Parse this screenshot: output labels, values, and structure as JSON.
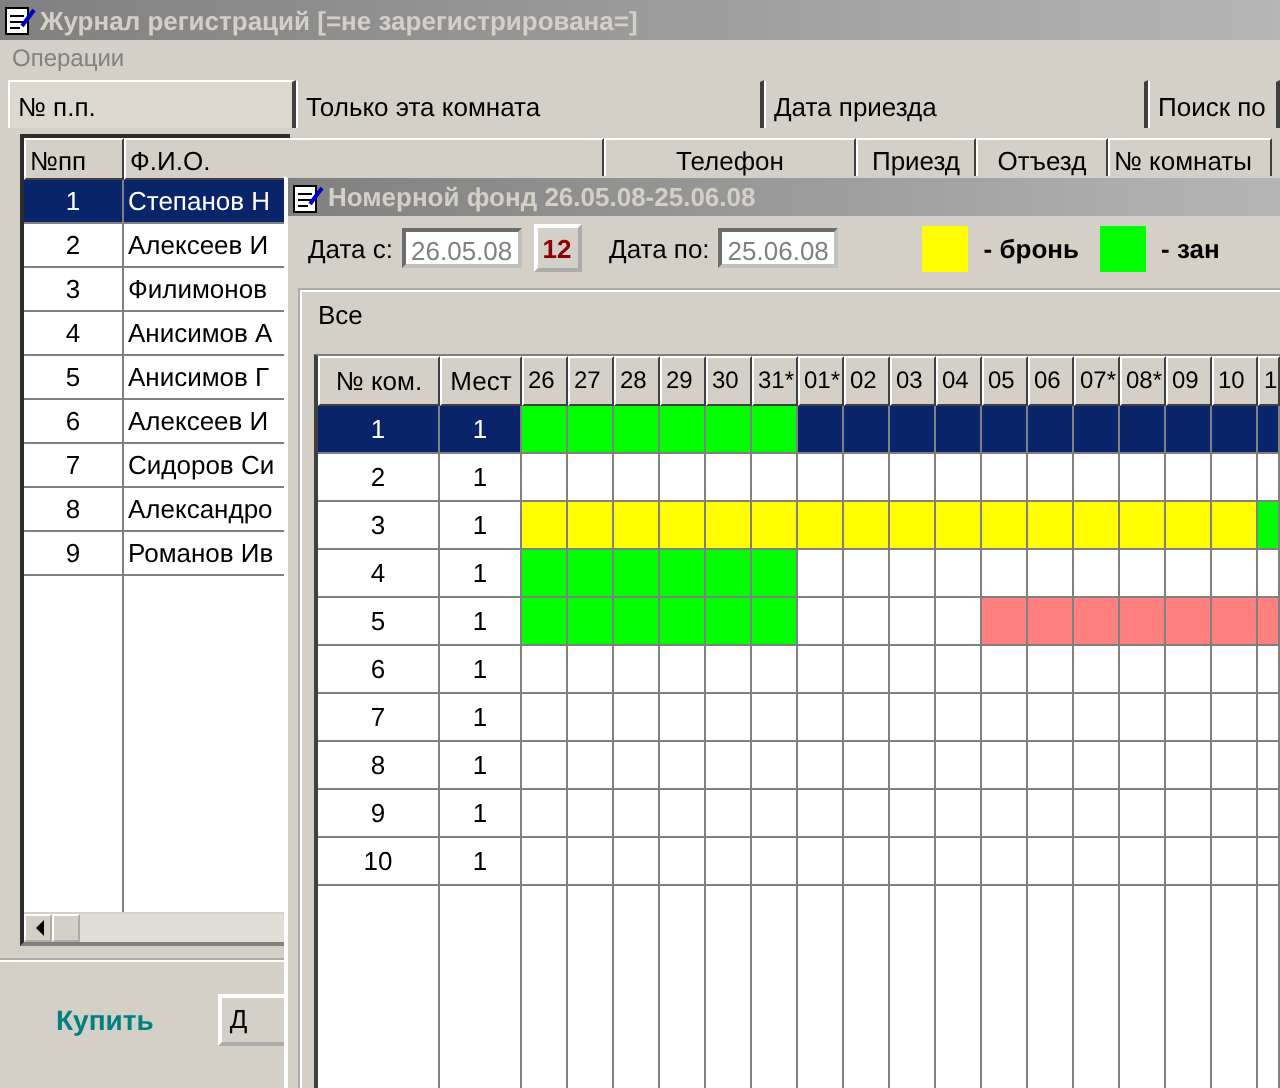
{
  "window": {
    "title": "Журнал регистраций [=не зарегистрирована=]"
  },
  "menu": [
    "Операции"
  ],
  "tabs": [
    {
      "label": "№ п.п.",
      "selected": true
    },
    {
      "label": "Только эта комната",
      "selected": false
    },
    {
      "label": "Дата приезда",
      "selected": false
    },
    {
      "label": "Поиск по",
      "selected": false
    }
  ],
  "guests": {
    "columns": [
      "№пп",
      "Ф.И.О.",
      "Телефон",
      "Приезд",
      "Отъезд",
      "№ комнаты"
    ],
    "rows": [
      {
        "number": "1",
        "name": "Степанов Н",
        "selected": true
      },
      {
        "number": "2",
        "name": "Алексеев И",
        "selected": false
      },
      {
        "number": "3",
        "name": "Филимонов",
        "selected": false
      },
      {
        "number": "4",
        "name": "Анисимов А",
        "selected": false
      },
      {
        "number": "5",
        "name": "Анисимов Г",
        "selected": false
      },
      {
        "number": "6",
        "name": "Алексеев И",
        "selected": false
      },
      {
        "number": "7",
        "name": "Сидоров Си",
        "selected": false
      },
      {
        "number": "8",
        "name": "Александро",
        "selected": false
      },
      {
        "number": "9",
        "name": "Романов Ив",
        "selected": false
      }
    ]
  },
  "buttons": [
    {
      "label": "Купить",
      "kind": "link"
    },
    {
      "label": "Д",
      "kind": "push"
    }
  ],
  "room_window": {
    "title": "Номерной фонд 26.05.08-25.06.08",
    "date_from": {
      "label": "Дата с:",
      "value": "26.05.08"
    },
    "calendar_button": "12",
    "date_to": {
      "label": "Дата по:",
      "value": "25.06.08"
    },
    "legend": [
      {
        "color": "#ffff00",
        "label": "- бронь"
      },
      {
        "color": "#00ff00",
        "label": "- зан"
      }
    ],
    "group": "Все",
    "columns": [
      "№ ком.",
      "Мест"
    ],
    "days": [
      "26",
      "27",
      "28",
      "29",
      "30",
      "31*",
      "01*",
      "02",
      "03",
      "04",
      "05",
      "06",
      "07*",
      "08*",
      "09",
      "10",
      "1"
    ],
    "rooms": [
      {
        "number": "1",
        "places": "1",
        "selected": true,
        "days": [
          {
            "kind": "occupied"
          },
          {
            "kind": "occupied"
          },
          {
            "kind": "occupied"
          },
          {
            "kind": "occupied"
          },
          {
            "kind": "occupied"
          },
          {
            "kind": "occupied"
          },
          {
            "kind": "free"
          },
          {
            "kind": "free"
          },
          {
            "kind": "free"
          },
          {
            "kind": "free"
          },
          {
            "kind": "free"
          },
          {
            "kind": "free"
          },
          {
            "kind": "free"
          },
          {
            "kind": "free"
          },
          {
            "kind": "free"
          },
          {
            "kind": "free"
          },
          {
            "kind": "free"
          }
        ]
      },
      {
        "number": "2",
        "places": "1",
        "selected": false,
        "days": [
          {
            "kind": "free"
          },
          {
            "kind": "free"
          },
          {
            "kind": "free"
          },
          {
            "kind": "free"
          },
          {
            "kind": "free"
          },
          {
            "kind": "free"
          },
          {
            "kind": "free"
          },
          {
            "kind": "free"
          },
          {
            "kind": "free"
          },
          {
            "kind": "free"
          },
          {
            "kind": "free"
          },
          {
            "kind": "free"
          },
          {
            "kind": "free"
          },
          {
            "kind": "free"
          },
          {
            "kind": "free"
          },
          {
            "kind": "free"
          },
          {
            "kind": "free"
          }
        ]
      },
      {
        "number": "3",
        "places": "1",
        "selected": false,
        "days": [
          {
            "kind": "booked"
          },
          {
            "kind": "booked"
          },
          {
            "kind": "booked"
          },
          {
            "kind": "booked"
          },
          {
            "kind": "booked"
          },
          {
            "kind": "booked"
          },
          {
            "kind": "booked"
          },
          {
            "kind": "booked"
          },
          {
            "kind": "booked"
          },
          {
            "kind": "booked"
          },
          {
            "kind": "booked"
          },
          {
            "kind": "booked"
          },
          {
            "kind": "booked"
          },
          {
            "kind": "booked"
          },
          {
            "kind": "booked"
          },
          {
            "kind": "booked"
          },
          {
            "kind": "occupied"
          }
        ]
      },
      {
        "number": "4",
        "places": "1",
        "selected": false,
        "days": [
          {
            "kind": "occupied"
          },
          {
            "kind": "occupied"
          },
          {
            "kind": "occupied"
          },
          {
            "kind": "occupied"
          },
          {
            "kind": "occupied"
          },
          {
            "kind": "occupied"
          },
          {
            "kind": "free"
          },
          {
            "kind": "free"
          },
          {
            "kind": "free"
          },
          {
            "kind": "free"
          },
          {
            "kind": "free"
          },
          {
            "kind": "free"
          },
          {
            "kind": "free"
          },
          {
            "kind": "free"
          },
          {
            "kind": "free"
          },
          {
            "kind": "free"
          },
          {
            "kind": "free"
          }
        ]
      },
      {
        "number": "5",
        "places": "1",
        "selected": false,
        "days": [
          {
            "kind": "occupied"
          },
          {
            "kind": "occupied"
          },
          {
            "kind": "occupied"
          },
          {
            "kind": "occupied"
          },
          {
            "kind": "occupied"
          },
          {
            "kind": "occupied"
          },
          {
            "kind": "free"
          },
          {
            "kind": "free"
          },
          {
            "kind": "free"
          },
          {
            "kind": "free"
          },
          {
            "kind": "pending"
          },
          {
            "kind": "pending"
          },
          {
            "kind": "pending"
          },
          {
            "kind": "pending"
          },
          {
            "kind": "pending"
          },
          {
            "kind": "pending"
          },
          {
            "kind": "pending"
          }
        ]
      },
      {
        "number": "6",
        "places": "1",
        "selected": false,
        "days": [
          {
            "kind": "free"
          },
          {
            "kind": "free"
          },
          {
            "kind": "free"
          },
          {
            "kind": "free"
          },
          {
            "kind": "free"
          },
          {
            "kind": "free"
          },
          {
            "kind": "free"
          },
          {
            "kind": "free"
          },
          {
            "kind": "free"
          },
          {
            "kind": "free"
          },
          {
            "kind": "free"
          },
          {
            "kind": "free"
          },
          {
            "kind": "free"
          },
          {
            "kind": "free"
          },
          {
            "kind": "free"
          },
          {
            "kind": "free"
          },
          {
            "kind": "free"
          }
        ]
      },
      {
        "number": "7",
        "places": "1",
        "selected": false,
        "days": [
          {
            "kind": "free"
          },
          {
            "kind": "free"
          },
          {
            "kind": "free"
          },
          {
            "kind": "free"
          },
          {
            "kind": "free"
          },
          {
            "kind": "free"
          },
          {
            "kind": "free"
          },
          {
            "kind": "free"
          },
          {
            "kind": "free"
          },
          {
            "kind": "free"
          },
          {
            "kind": "free"
          },
          {
            "kind": "free"
          },
          {
            "kind": "free"
          },
          {
            "kind": "free"
          },
          {
            "kind": "free"
          },
          {
            "kind": "free"
          },
          {
            "kind": "free"
          }
        ]
      },
      {
        "number": "8",
        "places": "1",
        "selected": false,
        "days": [
          {
            "kind": "free"
          },
          {
            "kind": "free"
          },
          {
            "kind": "free"
          },
          {
            "kind": "free"
          },
          {
            "kind": "free"
          },
          {
            "kind": "free"
          },
          {
            "kind": "free"
          },
          {
            "kind": "free"
          },
          {
            "kind": "free"
          },
          {
            "kind": "free"
          },
          {
            "kind": "free"
          },
          {
            "kind": "free"
          },
          {
            "kind": "free"
          },
          {
            "kind": "free"
          },
          {
            "kind": "free"
          },
          {
            "kind": "free"
          },
          {
            "kind": "free"
          }
        ]
      },
      {
        "number": "9",
        "places": "1",
        "selected": false,
        "days": [
          {
            "kind": "free"
          },
          {
            "kind": "free"
          },
          {
            "kind": "free"
          },
          {
            "kind": "free"
          },
          {
            "kind": "free"
          },
          {
            "kind": "free"
          },
          {
            "kind": "free"
          },
          {
            "kind": "free"
          },
          {
            "kind": "free"
          },
          {
            "kind": "free"
          },
          {
            "kind": "free"
          },
          {
            "kind": "free"
          },
          {
            "kind": "free"
          },
          {
            "kind": "free"
          },
          {
            "kind": "free"
          },
          {
            "kind": "free"
          },
          {
            "kind": "free"
          }
        ]
      },
      {
        "number": "10",
        "places": "1",
        "selected": false,
        "days": [
          {
            "kind": "free"
          },
          {
            "kind": "free"
          },
          {
            "kind": "free"
          },
          {
            "kind": "free"
          },
          {
            "kind": "free"
          },
          {
            "kind": "free"
          },
          {
            "kind": "free"
          },
          {
            "kind": "free"
          },
          {
            "kind": "free"
          },
          {
            "kind": "free"
          },
          {
            "kind": "free"
          },
          {
            "kind": "free"
          },
          {
            "kind": "free"
          },
          {
            "kind": "free"
          },
          {
            "kind": "free"
          },
          {
            "kind": "free"
          },
          {
            "kind": "free"
          }
        ]
      }
    ]
  }
}
